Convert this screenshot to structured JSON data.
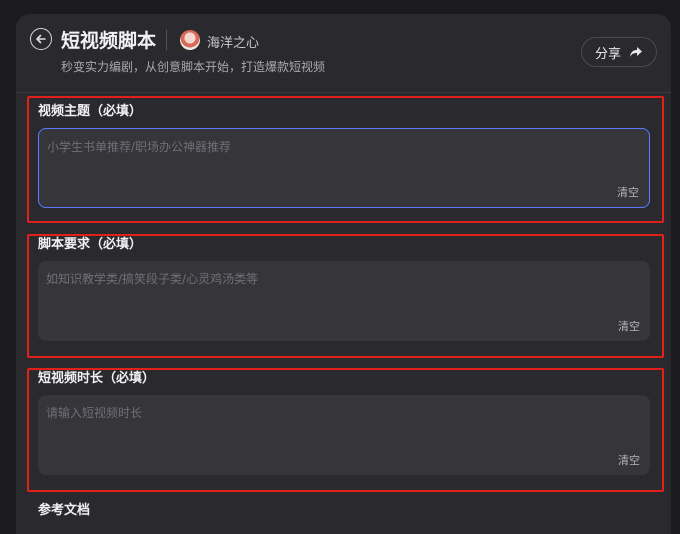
{
  "header": {
    "back_icon": "arrow-left-icon",
    "title": "短视频脚本",
    "author": "海洋之心",
    "subtitle": "秒变实力编剧，从创意脚本开始，打造爆款短视频",
    "share_label": "分享",
    "share_icon": "share-arrow-icon"
  },
  "form": {
    "topic": {
      "label": "视频主题（必填）",
      "placeholder": "小学生书单推荐/职场办公神器推荐",
      "clear_label": "清空"
    },
    "requirement": {
      "label": "脚本要求（必填）",
      "placeholder": "如知识教学类/搞笑段子类/心灵鸡汤类等",
      "clear_label": "清空"
    },
    "duration": {
      "label": "短视频时长（必填）",
      "placeholder": "请输入短视频时长",
      "clear_label": "清空"
    },
    "reference_label": "参考文档"
  },
  "colors": {
    "highlight": "#e0211b",
    "focus_border": "#5b79ff"
  }
}
